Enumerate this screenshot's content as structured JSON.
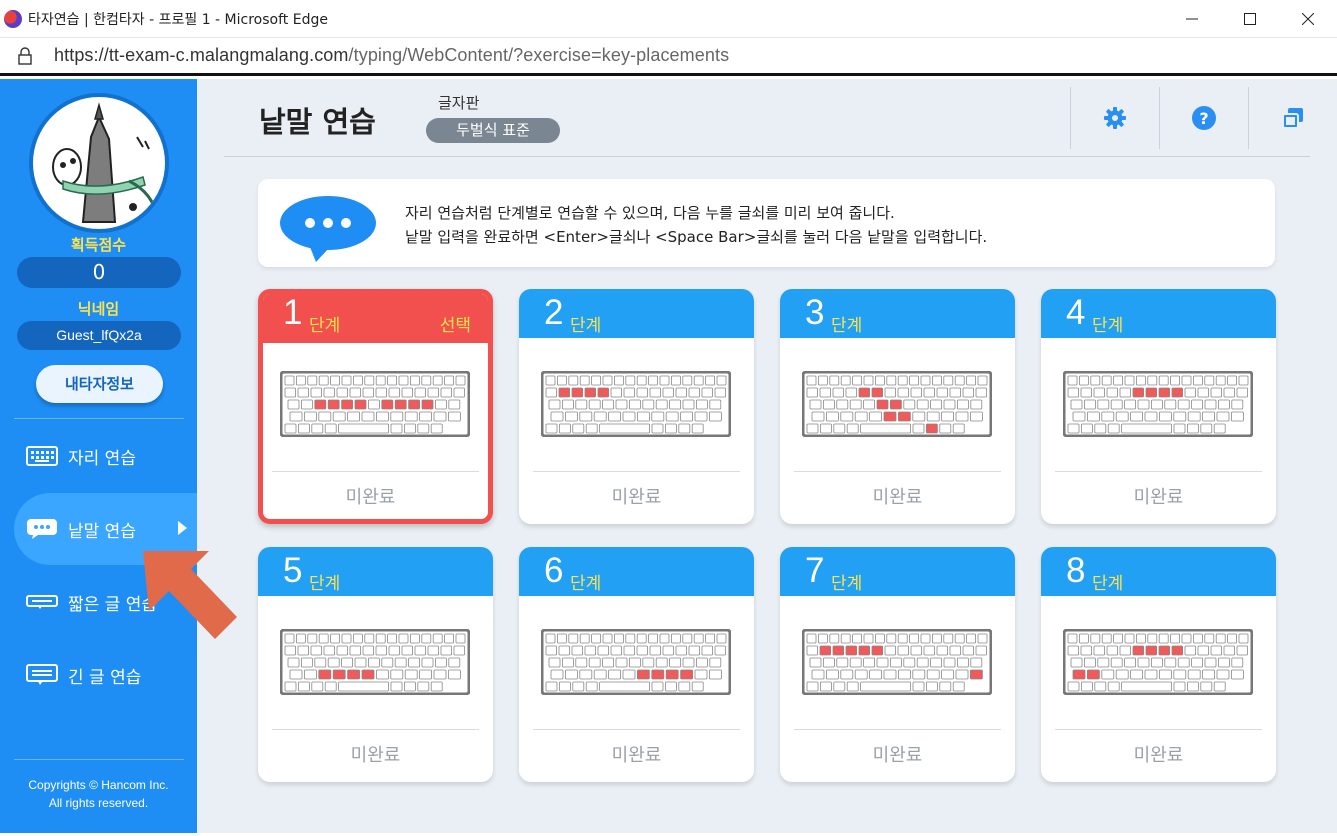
{
  "window": {
    "title": "타자연습 | 한컴타자 - 프로필 1 - Microsoft Edge",
    "url_main": "https://tt-exam-c.malangmalang.com",
    "url_path": "/typing/WebContent/?exercise=key-placements"
  },
  "sidebar": {
    "score_label": "획득점수",
    "score": "0",
    "nickname_label": "닉네임",
    "nickname": "Guest_lfQx2a",
    "my_info_button": "내타자정보",
    "menu": [
      {
        "label": "자리 연습",
        "icon": "keyboard-icon"
      },
      {
        "label": "낱말 연습",
        "icon": "speech-bubble-icon",
        "active": true
      },
      {
        "label": "짧은 글 연습",
        "icon": "short-text-icon"
      },
      {
        "label": "긴 글 연습",
        "icon": "long-text-icon"
      }
    ],
    "copyright_line1": "Copyrights © Hancom Inc.",
    "copyright_line2": "All rights reserved."
  },
  "header": {
    "title": "낱말 연습",
    "keyboard_label": "글자판",
    "keyboard_layout": "두벌식 표준",
    "icons": [
      "gear-icon",
      "help-icon",
      "window-icon"
    ]
  },
  "info": {
    "line1": "자리 연습처럼 단계별로 연습할 수 있으며, 다음 누를 글쇠를 미리 보여 줍니다.",
    "line2": "낱말 입력을 완료하면 <Enter>글쇠나 <Space Bar>글쇠를 눌러 다음 낱말을 입력합니다."
  },
  "stages": [
    {
      "num": "1",
      "step": "단계",
      "select": "선택",
      "status": "미완료"
    },
    {
      "num": "2",
      "step": "단계",
      "status": "미완료"
    },
    {
      "num": "3",
      "step": "단계",
      "status": "미완료"
    },
    {
      "num": "4",
      "step": "단계",
      "status": "미완료"
    },
    {
      "num": "5",
      "step": "단계",
      "status": "미완료"
    },
    {
      "num": "6",
      "step": "단계",
      "status": "미완료"
    },
    {
      "num": "7",
      "step": "단계",
      "status": "미완료"
    },
    {
      "num": "8",
      "step": "단계",
      "status": "미완료"
    }
  ],
  "colors": {
    "sidebar": "#1e8ef5",
    "card_head": "#22a0f4",
    "selected": "#f24f4f",
    "highlight_key": "#f05a5a",
    "arrow": "#e06a4a"
  }
}
